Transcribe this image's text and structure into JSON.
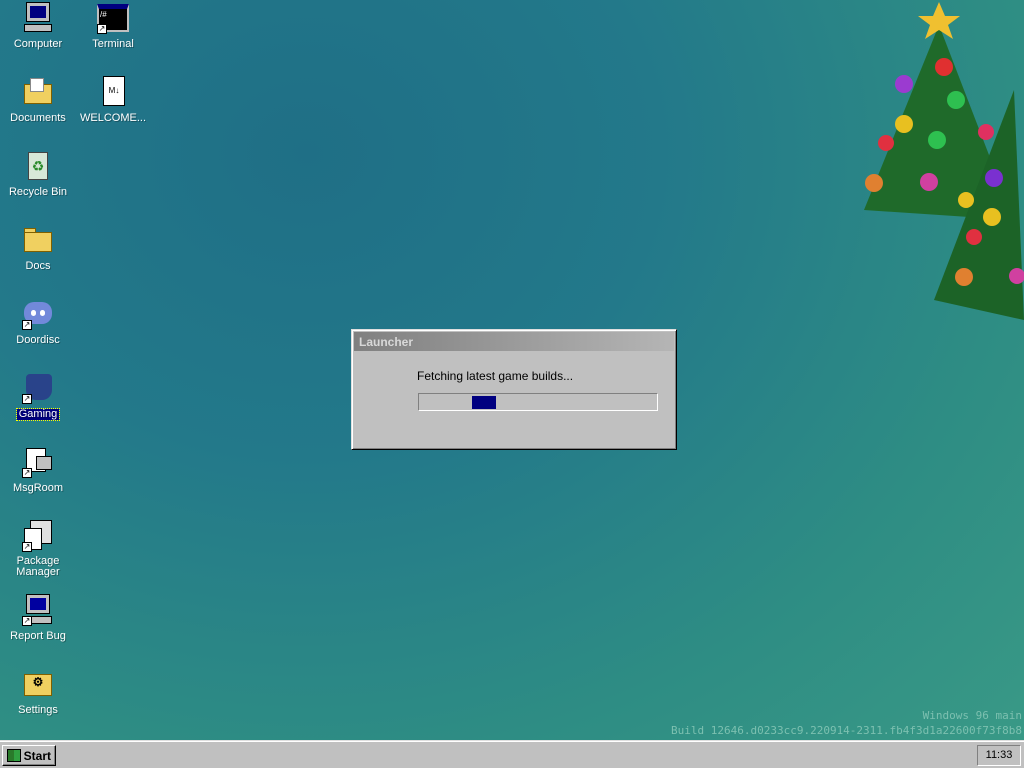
{
  "desktop": {
    "icons": [
      {
        "label": "Computer",
        "icon": "computer-icon"
      },
      {
        "label": "Terminal",
        "icon": "terminal-icon",
        "shortcut": true
      },
      {
        "label": "Documents",
        "icon": "documents-folder-icon"
      },
      {
        "label": "WELCOME...",
        "icon": "markdown-file-icon"
      },
      {
        "label": "Recycle Bin",
        "icon": "recycle-bin-icon"
      },
      {
        "label": "Docs",
        "icon": "folder-icon"
      },
      {
        "label": "Doordisc",
        "icon": "doordisc-icon",
        "shortcut": true
      },
      {
        "label": "Gaming",
        "icon": "gaming-icon",
        "shortcut": true,
        "selected": true
      },
      {
        "label": "MsgRoom",
        "icon": "msgroom-icon",
        "shortcut": true
      },
      {
        "label": "Package Manager",
        "icon": "package-manager-icon",
        "shortcut": true
      },
      {
        "label": "Report Bug",
        "icon": "report-bug-icon",
        "shortcut": true
      },
      {
        "label": "Settings",
        "icon": "settings-icon"
      }
    ]
  },
  "dialog": {
    "title": "Launcher",
    "message": "Fetching latest game builds...",
    "progress": "indeterminate",
    "progress_color": "#000080"
  },
  "watermark": {
    "line1": "Windows 96 main",
    "line2": "Build 12646.d0233cc9.220914-2311.fb4f3d1a22600f73f8b8"
  },
  "taskbar": {
    "start_label": "Start",
    "clock": "11:33"
  }
}
